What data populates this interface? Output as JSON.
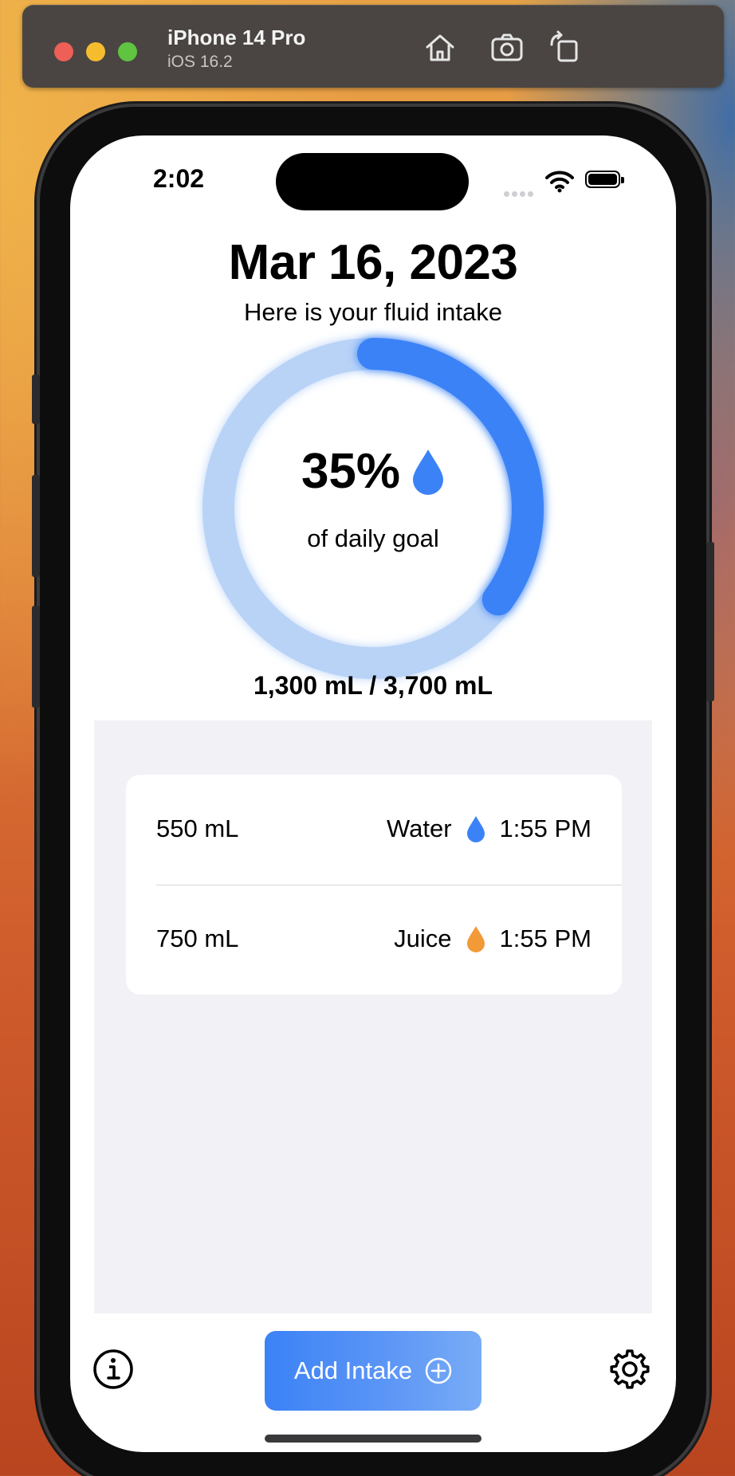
{
  "simulator": {
    "device_name": "iPhone 14 Pro",
    "os_version": "iOS 16.2",
    "icons": [
      "home-icon",
      "screenshot-icon",
      "rotate-icon"
    ]
  },
  "status_bar": {
    "time": "2:02"
  },
  "header": {
    "date": "Mar 16, 2023",
    "subtitle": "Here is your fluid intake"
  },
  "progress": {
    "percent_label": "35%",
    "percent_value": 35,
    "caption": "of daily goal",
    "totals": "1,300 mL / 3,700 mL",
    "ring_color": "#3b82f6",
    "track_color": "#b9d3f7"
  },
  "intake_list": [
    {
      "amount": "550 mL",
      "kind": "Water",
      "time": "1:55 PM",
      "drop_color": "#3b82f6"
    },
    {
      "amount": "750 mL",
      "kind": "Juice",
      "time": "1:55 PM",
      "drop_color": "#f29a38"
    }
  ],
  "bottom_bar": {
    "add_label": "Add Intake",
    "info_icon": "info-icon",
    "settings_icon": "gear-icon"
  }
}
